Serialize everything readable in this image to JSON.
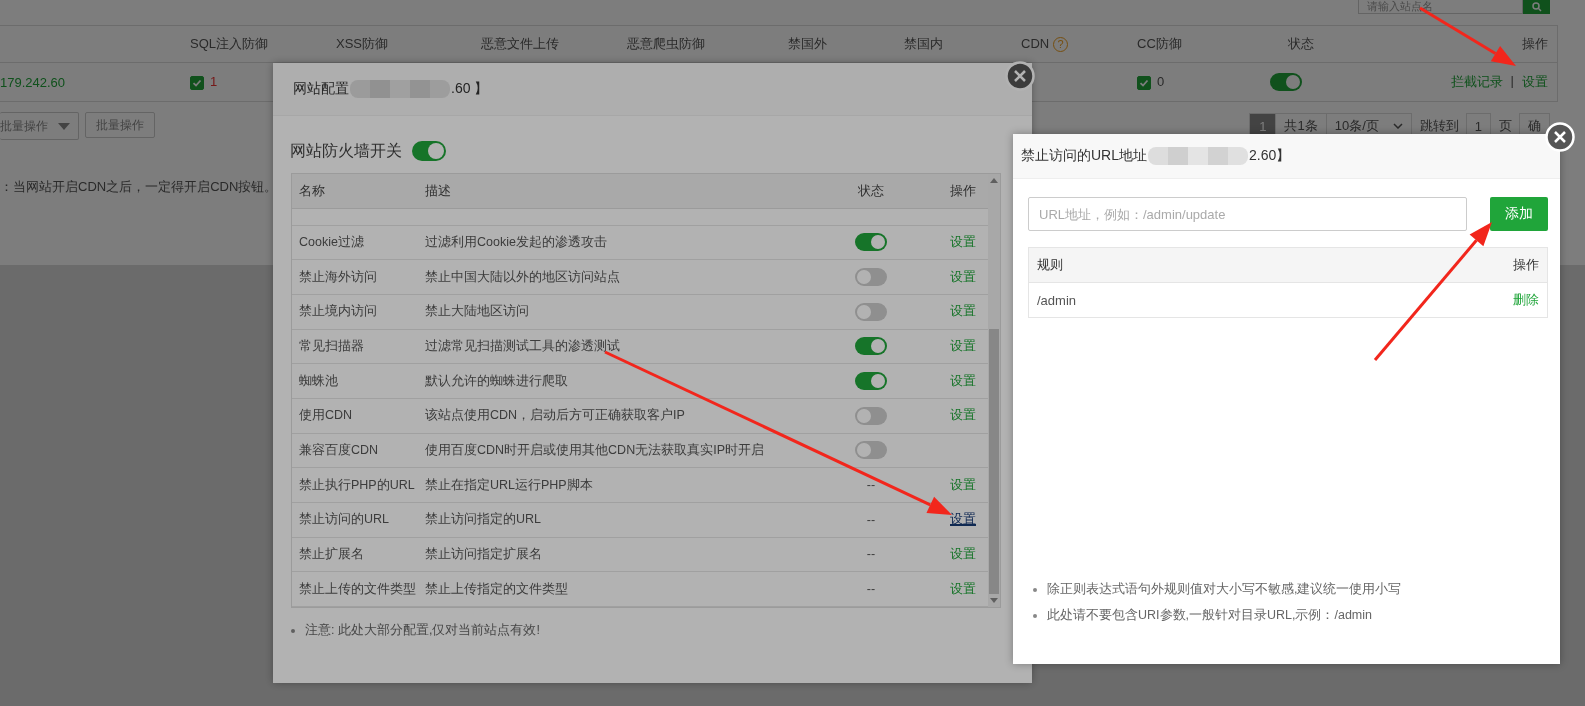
{
  "site_search": {
    "placeholder": "请输入站点名"
  },
  "site_table": {
    "columns": [
      {
        "label": "SQL注入防御"
      },
      {
        "label": "XSS防御"
      },
      {
        "label": "恶意文件上传"
      },
      {
        "label": "恶意爬虫防御"
      },
      {
        "label": "禁国外"
      },
      {
        "label": "禁国内"
      },
      {
        "label": "CDN",
        "help": "?"
      },
      {
        "label": "CC防御"
      },
      {
        "label": "状态"
      },
      {
        "label": "操作"
      }
    ],
    "rows": [
      {
        "site": "179.242.60",
        "sql": {
          "checked": true,
          "count": "1"
        },
        "cc": {
          "checked": true,
          "count": "0"
        },
        "status_on": true,
        "actions": [
          "拦截记录",
          "设置"
        ],
        "separator": "|"
      }
    ]
  },
  "batch": {
    "select": "批量操作",
    "button": "批量操作"
  },
  "pagination": {
    "pages": [
      {
        "label": "1",
        "selected": true
      }
    ],
    "total": "共1条",
    "per_page": "10条/页",
    "jump_label": "跳转到",
    "jump_value": "1",
    "page_unit": "页",
    "confirm": "确"
  },
  "page_note": "：当网站开启CDN之后，一定得开启CDN按钮。",
  "site_config_dialog": {
    "title_prefix": "网站配置",
    "title_suffix": ".60 】",
    "firewall_label": "网站防火墙开关",
    "firewall_on": true,
    "columns": [
      "名称",
      "描述",
      "状态",
      "操作"
    ],
    "rows": [
      {
        "name": "Cookie过滤",
        "description": "过滤利用Cookie发起的渗透攻击",
        "kind": "toggle",
        "on": true,
        "action": "设置",
        "hovered": false
      },
      {
        "name": "禁止海外访问",
        "description": "禁止中国大陆以外的地区访问站点",
        "kind": "toggle",
        "on": false,
        "action": "设置",
        "hovered": false
      },
      {
        "name": "禁止境内访问",
        "description": "禁止大陆地区访问",
        "kind": "toggle",
        "on": false,
        "action": "设置",
        "hovered": false
      },
      {
        "name": "常见扫描器",
        "description": "过滤常见扫描测试工具的渗透测试",
        "kind": "toggle",
        "on": true,
        "action": "设置",
        "hovered": false
      },
      {
        "name": "蜘蛛池",
        "description": "默认允许的蜘蛛进行爬取",
        "kind": "toggle",
        "on": true,
        "action": "设置",
        "hovered": false
      },
      {
        "name": "使用CDN",
        "description": "该站点使用CDN，启动后方可正确获取客户IP",
        "kind": "toggle",
        "on": false,
        "action": "设置",
        "hovered": false
      },
      {
        "name": "兼容百度CDN",
        "description": "使用百度CDN时开启或使用其他CDN无法获取真实IP时开启",
        "kind": "toggle",
        "on": false
      },
      {
        "name": "禁止执行PHP的URL",
        "description": "禁止在指定URL运行PHP脚本",
        "kind": "text",
        "status": "--",
        "action": "设置",
        "hovered": false
      },
      {
        "name": "禁止访问的URL",
        "description": "禁止访问指定的URL",
        "kind": "text",
        "status": "--",
        "action": "设置",
        "hovered": true
      },
      {
        "name": "禁止扩展名",
        "description": "禁止访问指定扩展名",
        "kind": "text",
        "status": "--",
        "action": "设置",
        "hovered": false
      },
      {
        "name": "禁止上传的文件类型",
        "description": "禁止上传指定的文件类型",
        "kind": "text",
        "status": "--",
        "action": "设置",
        "hovered": false
      }
    ],
    "note": "注意: 此处大部分配置,仅对当前站点有效!"
  },
  "url_dialog": {
    "title_prefix": "禁止访问的URL地址",
    "title_suffix": "2.60】",
    "input": {
      "placeholder": "URL地址，例如：/admin/update"
    },
    "add_button": "添加",
    "columns": [
      "规则",
      "操作"
    ],
    "rows": [
      {
        "rule": "/admin",
        "action": "删除"
      }
    ],
    "notes": [
      "除正则表达式语句外规则值对大小写不敏感,建议统一使用小写",
      "此处请不要包含URI参数,一般针对目录URL,示例：/admin"
    ]
  }
}
